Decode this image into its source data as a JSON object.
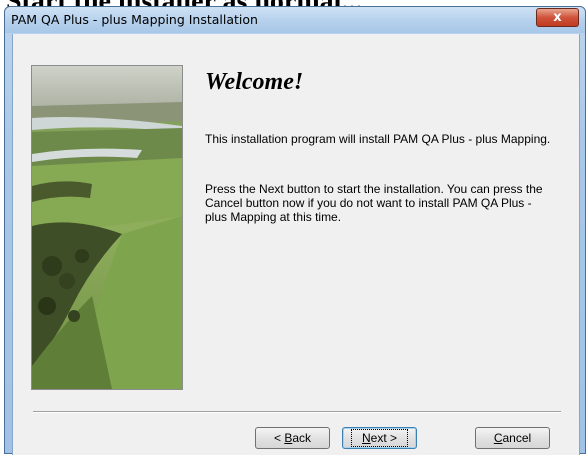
{
  "page": {
    "heading": "Start the installer as normal..."
  },
  "window": {
    "title": "PAM QA Plus - plus Mapping Installation",
    "close_glyph": "x"
  },
  "content": {
    "welcome": "Welcome!",
    "paragraph1": "This installation program will install PAM QA Plus - plus Mapping.",
    "paragraph2": "Press the Next button to start the installation. You can press the Cancel button now if you do not want to install PAM QA Plus - plus Mapping at this time."
  },
  "buttons": {
    "back_prefix": "< ",
    "back_mnemonic": "B",
    "back_rest": "ack",
    "next_mnemonic": "N",
    "next_rest": "ext >",
    "cancel_mnemonic": "C",
    "cancel_rest": "ancel"
  },
  "icons": {
    "close": "close-icon",
    "side_image": "landscape-image"
  }
}
